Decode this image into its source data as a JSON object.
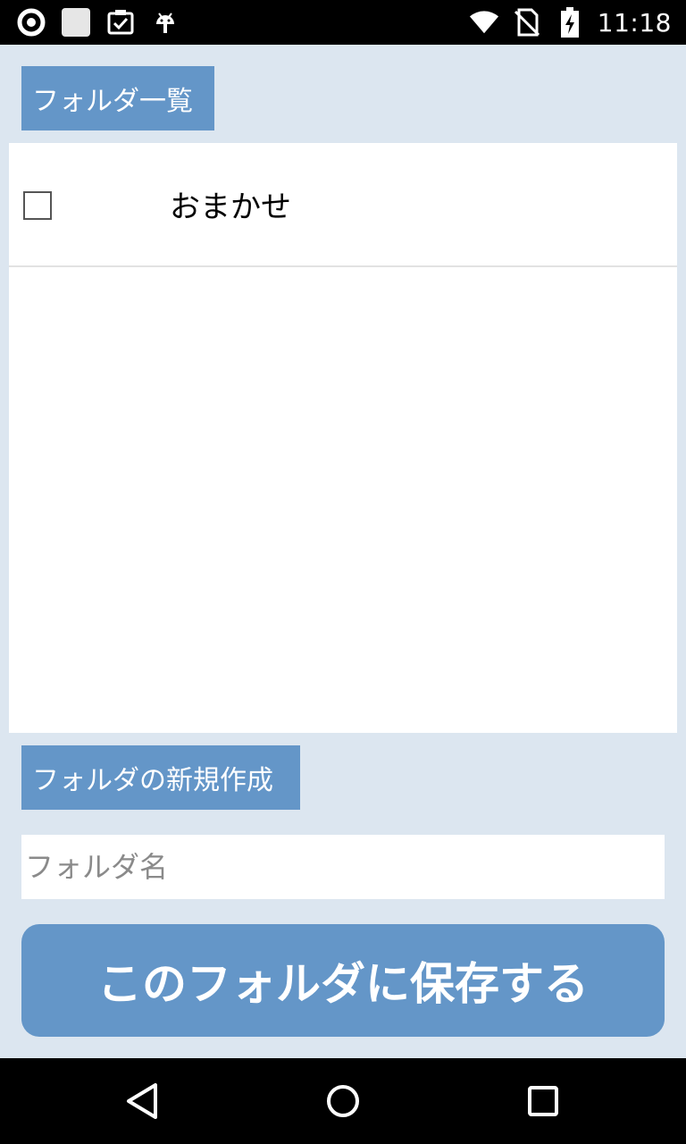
{
  "status_bar": {
    "time": "11:18",
    "left_icons": [
      "app-notification-icon",
      "image-placeholder-icon",
      "clipboard-check-icon",
      "android-icon"
    ],
    "right_icons": [
      "wifi-icon",
      "no-sim-icon",
      "battery-charging-icon"
    ]
  },
  "folder_list": {
    "header": "フォルダ一覧",
    "items": [
      {
        "name": "おまかせ",
        "checked": false
      }
    ]
  },
  "new_folder": {
    "header": "フォルダの新規作成",
    "input_placeholder": "フォルダ名",
    "input_value": ""
  },
  "save_button": {
    "label": "このフォルダに保存する"
  },
  "colors": {
    "background": "#dce6f0",
    "accent": "#6496c8",
    "panel": "#ffffff"
  }
}
